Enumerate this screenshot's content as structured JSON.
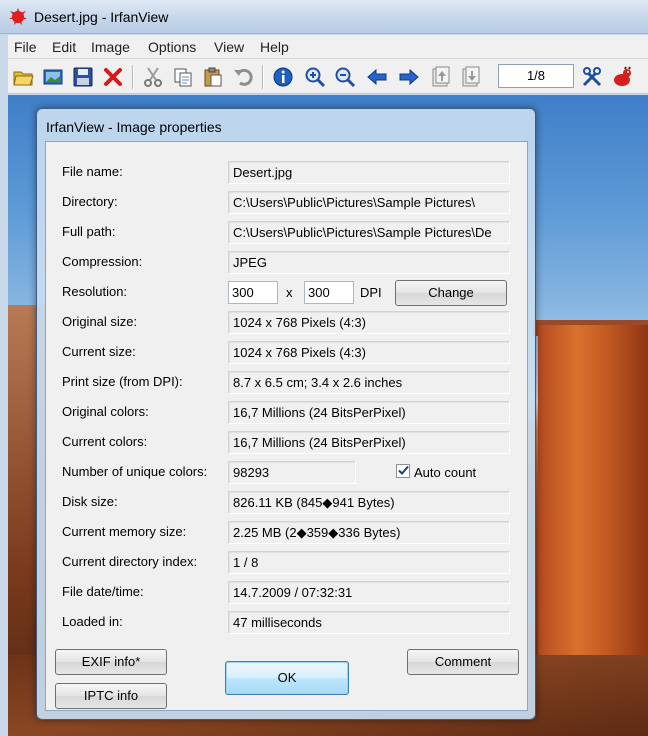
{
  "window": {
    "title": "Desert.jpg - IrfanView"
  },
  "menu": [
    "File",
    "Edit",
    "Image",
    "Options",
    "View",
    "Help"
  ],
  "toolbar": {
    "page_counter": "1/8"
  },
  "dialog": {
    "title": "IrfanView - Image properties",
    "rows": [
      {
        "label": "File name:",
        "value": "Desert.jpg"
      },
      {
        "label": "Directory:",
        "value": "C:\\Users\\Public\\Pictures\\Sample Pictures\\"
      },
      {
        "label": "Full path:",
        "value": "C:\\Users\\Public\\Pictures\\Sample Pictures\\De"
      },
      {
        "label": "Compression:",
        "value": "JPEG"
      },
      {
        "label": "Resolution:"
      },
      {
        "label": "Original size:",
        "value": "1024 x 768  Pixels (4:3)"
      },
      {
        "label": "Current size:",
        "value": "1024 x 768  Pixels (4:3)"
      },
      {
        "label": "Print size (from DPI):",
        "value": "8.7 x 6.5 cm; 3.4 x 2.6 inches"
      },
      {
        "label": "Original colors:",
        "value": "16,7 Millions  (24 BitsPerPixel)"
      },
      {
        "label": "Current colors:",
        "value": "16,7 Millions  (24 BitsPerPixel)"
      },
      {
        "label": "Number of unique colors:",
        "value": "98293"
      },
      {
        "label": "Disk size:",
        "value": "826.11 KB (845◆941 Bytes)"
      },
      {
        "label": "Current memory size:",
        "value": "2.25  MB (2◆359◆336 Bytes)"
      },
      {
        "label": "Current directory index:",
        "value": "1  /  8"
      },
      {
        "label": "File date/time:",
        "value": "14.7.2009 / 07:32:31"
      },
      {
        "label": "Loaded in:",
        "value": "47 milliseconds"
      }
    ],
    "resolution": {
      "x": "300",
      "separator": "x",
      "y": "300",
      "unit": "DPI",
      "change_label": "Change"
    },
    "auto_count": {
      "label": "Auto count",
      "checked": true
    },
    "buttons": {
      "exif": "EXIF info*",
      "iptc": "IPTC info",
      "ok": "OK",
      "comment": "Comment"
    }
  }
}
